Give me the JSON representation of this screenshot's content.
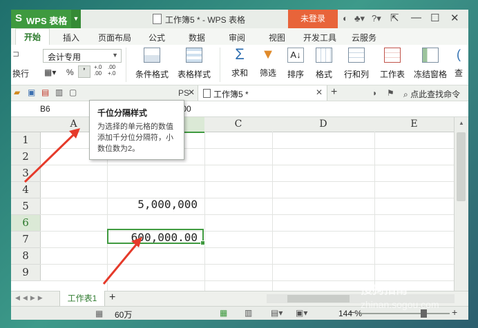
{
  "app": {
    "name": "WPS 表格",
    "doc_title": "工作簿5 * - WPS 表格",
    "login": "未登录"
  },
  "ribbon_tabs": [
    "开始",
    "插入",
    "页面布局",
    "公式",
    "数据",
    "审阅",
    "视图",
    "开发工具",
    "云服务"
  ],
  "ribbon": {
    "wrap_label": "换行",
    "number_format": "会计专用",
    "percent": "%",
    "dec_inc": "+.0 .00",
    "dec_dec": ".00 +.0",
    "buttons": [
      "条件格式",
      "表格样式",
      "求和",
      "筛选",
      "排序",
      "格式",
      "行和列",
      "工作表",
      "冻结窗格",
      "查"
    ]
  },
  "doc_tabs": {
    "left_fragment": "PS",
    "active": "工作簿5 *",
    "search": "点此查找命令"
  },
  "formula_bar": {
    "cell_name": "B6",
    "value_fragment": "0000"
  },
  "columns": [
    "A",
    "B",
    "C",
    "D",
    "E"
  ],
  "rows": [
    "1",
    "2",
    "3",
    "4",
    "5",
    "6",
    "7",
    "8",
    "9"
  ],
  "cells": {
    "B4": "5,000,000",
    "B6": "600,000.00"
  },
  "tooltip": {
    "title": "千位分隔样式",
    "desc": "为选择的单元格的数值添加千分位分隔符，小数位数为2。"
  },
  "sheets": [
    "工作表1"
  ],
  "status": {
    "sum": "60万",
    "zoom": "144 %"
  },
  "watermark": {
    "brand": "搜狗指南",
    "url": "zhinan.sogou.com"
  },
  "colors": {
    "accent": "#3f9a3f",
    "login": "#e8643a",
    "arrow": "#e53a2a"
  }
}
